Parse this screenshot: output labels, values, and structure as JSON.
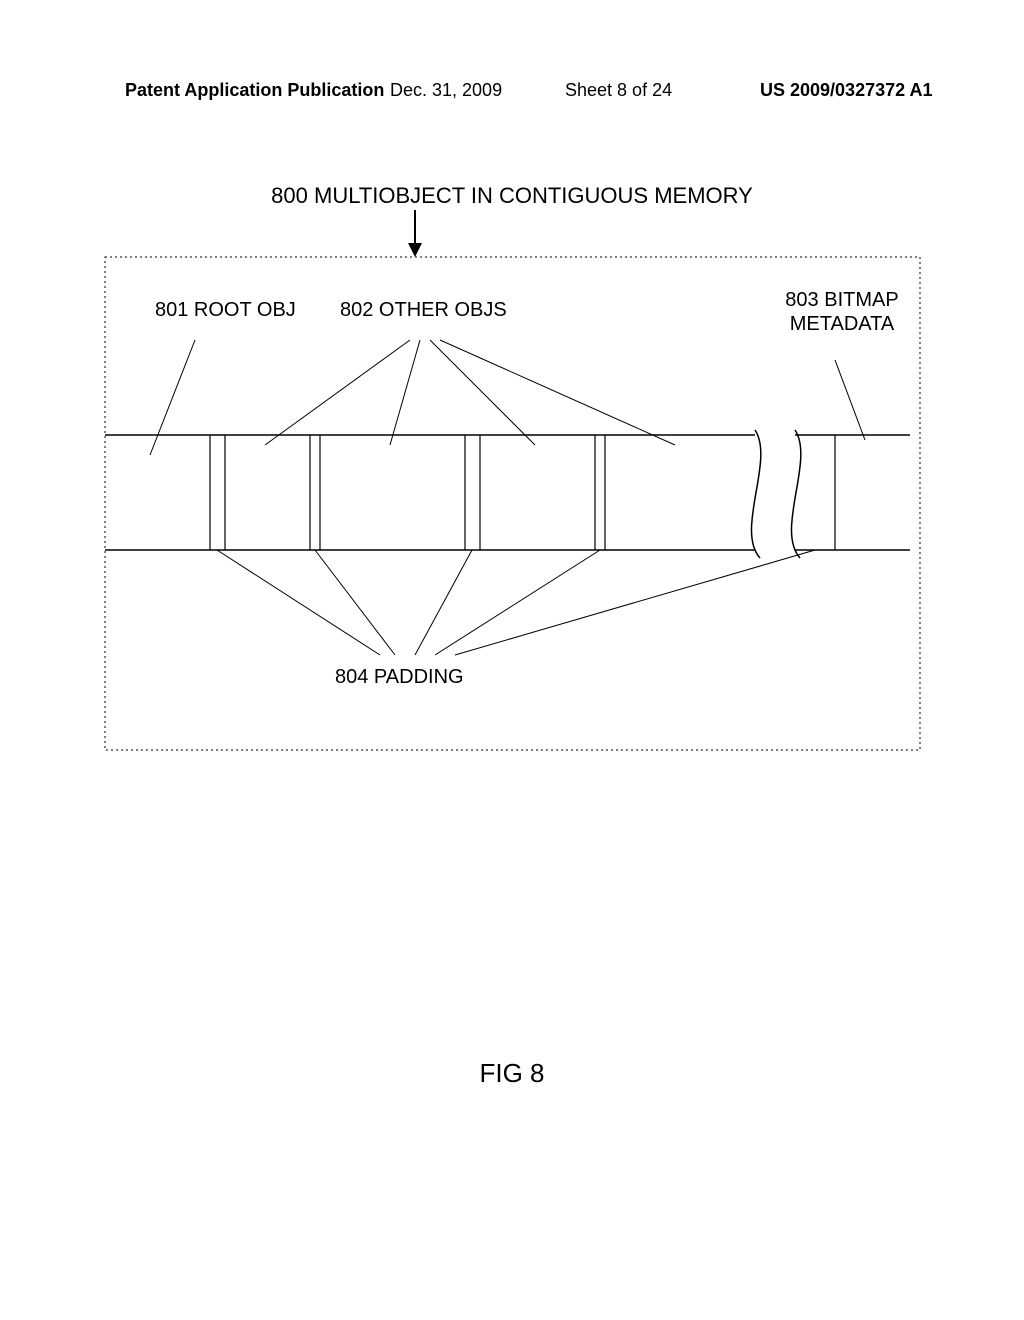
{
  "header": {
    "left": "Patent Application Publication",
    "date": "Dec. 31, 2009",
    "sheet": "Sheet 8 of 24",
    "right": "US 2009/0327372 A1"
  },
  "figure": {
    "title": "800 MULTIOBJECT IN CONTIGUOUS MEMORY",
    "label_root": "801 ROOT OBJ",
    "label_other": "802 OTHER OBJS",
    "label_bitmap_l1": "803 BITMAP",
    "label_bitmap_l2": "METADATA",
    "label_padding": "804 PADDING",
    "caption": "FIG 8"
  }
}
